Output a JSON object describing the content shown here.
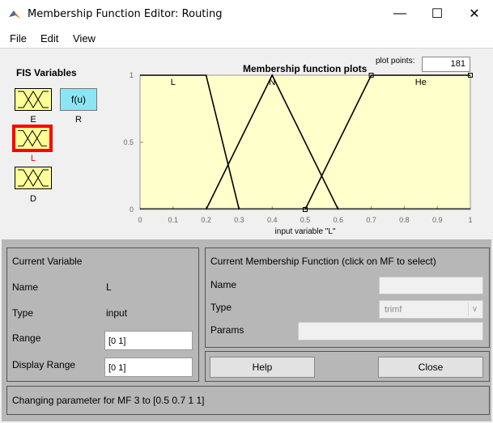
{
  "window": {
    "title": "Membership Function Editor: Routing",
    "controls": {
      "minimize": "—",
      "maximize": "☐",
      "close": "✕"
    }
  },
  "menu": [
    "File",
    "Edit",
    "View"
  ],
  "fis": {
    "title": "FIS Variables",
    "inputs": [
      {
        "label": "E",
        "selected": false
      },
      {
        "label": "L",
        "selected": true
      },
      {
        "label": "D",
        "selected": false
      }
    ],
    "function_box": "f(u)",
    "output_label": "R"
  },
  "plot": {
    "title": "Membership function plots",
    "plot_points_label": "plot points:",
    "plot_points_value": "181"
  },
  "chart_data": {
    "type": "line",
    "xlabel": "input variable \"L\"",
    "xlim": [
      0,
      1
    ],
    "ylim": [
      0,
      1
    ],
    "x_ticks": [
      "0",
      "0.1",
      "0.2",
      "0.3",
      "0.4",
      "0.5",
      "0.6",
      "0.7",
      "0.8",
      "0.9",
      "1"
    ],
    "y_ticks": [
      "0",
      "0.5",
      "1"
    ],
    "series": [
      {
        "name": "L",
        "points": [
          [
            0,
            1
          ],
          [
            0.2,
            1
          ],
          [
            0.3,
            0
          ]
        ]
      },
      {
        "name": "N",
        "points": [
          [
            0.2,
            0
          ],
          [
            0.4,
            1
          ],
          [
            0.6,
            0
          ]
        ]
      },
      {
        "name": "He",
        "points": [
          [
            0.5,
            0
          ],
          [
            0.7,
            1
          ],
          [
            1,
            1
          ]
        ]
      }
    ],
    "background_color": "#ffffcc",
    "line_color": "#000000"
  },
  "current_variable": {
    "title": "Current Variable",
    "name_label": "Name",
    "name_value": "L",
    "type_label": "Type",
    "type_value": "input",
    "range_label": "Range",
    "range_value": "[0 1]",
    "display_range_label": "Display Range",
    "display_range_value": "[0 1]"
  },
  "current_mf": {
    "title": "Current Membership Function (click on MF to select)",
    "name_label": "Name",
    "name_value": "",
    "type_label": "Type",
    "type_value": "trimf",
    "params_label": "Params",
    "params_value": ""
  },
  "buttons": {
    "help": "Help",
    "close": "Close"
  },
  "status": "Changing parameter for MF 3 to  [0.5 0.7 1 1]",
  "colors": {
    "selected_border": "#ff0000",
    "input_box": "#ffff99",
    "output_box": "#8be6f4",
    "panel": "#b7b7b7"
  }
}
